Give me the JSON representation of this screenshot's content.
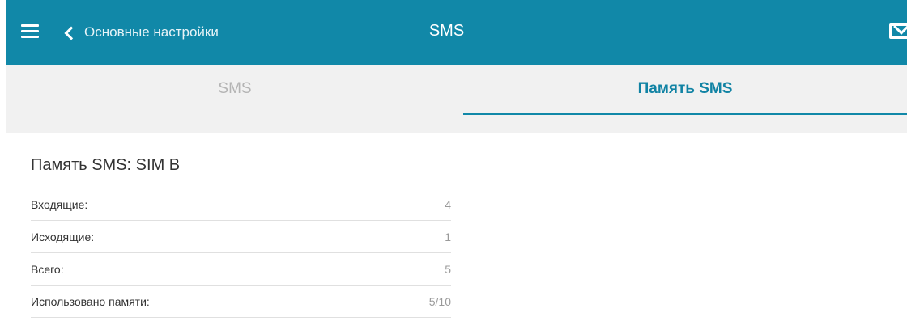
{
  "header": {
    "back_label": "Основные настройки",
    "title": "SMS",
    "accent_color": "#1188a8"
  },
  "tabs": [
    {
      "label": "SMS",
      "active": false
    },
    {
      "label": "Память SMS",
      "active": true
    }
  ],
  "section": {
    "title": "Память SMS: SIM B",
    "rows": [
      {
        "label": "Входящие:",
        "value": "4"
      },
      {
        "label": "Исходящие:",
        "value": "1"
      },
      {
        "label": "Всего:",
        "value": "5"
      },
      {
        "label": "Использовано памяти:",
        "value": "5/10"
      }
    ]
  }
}
